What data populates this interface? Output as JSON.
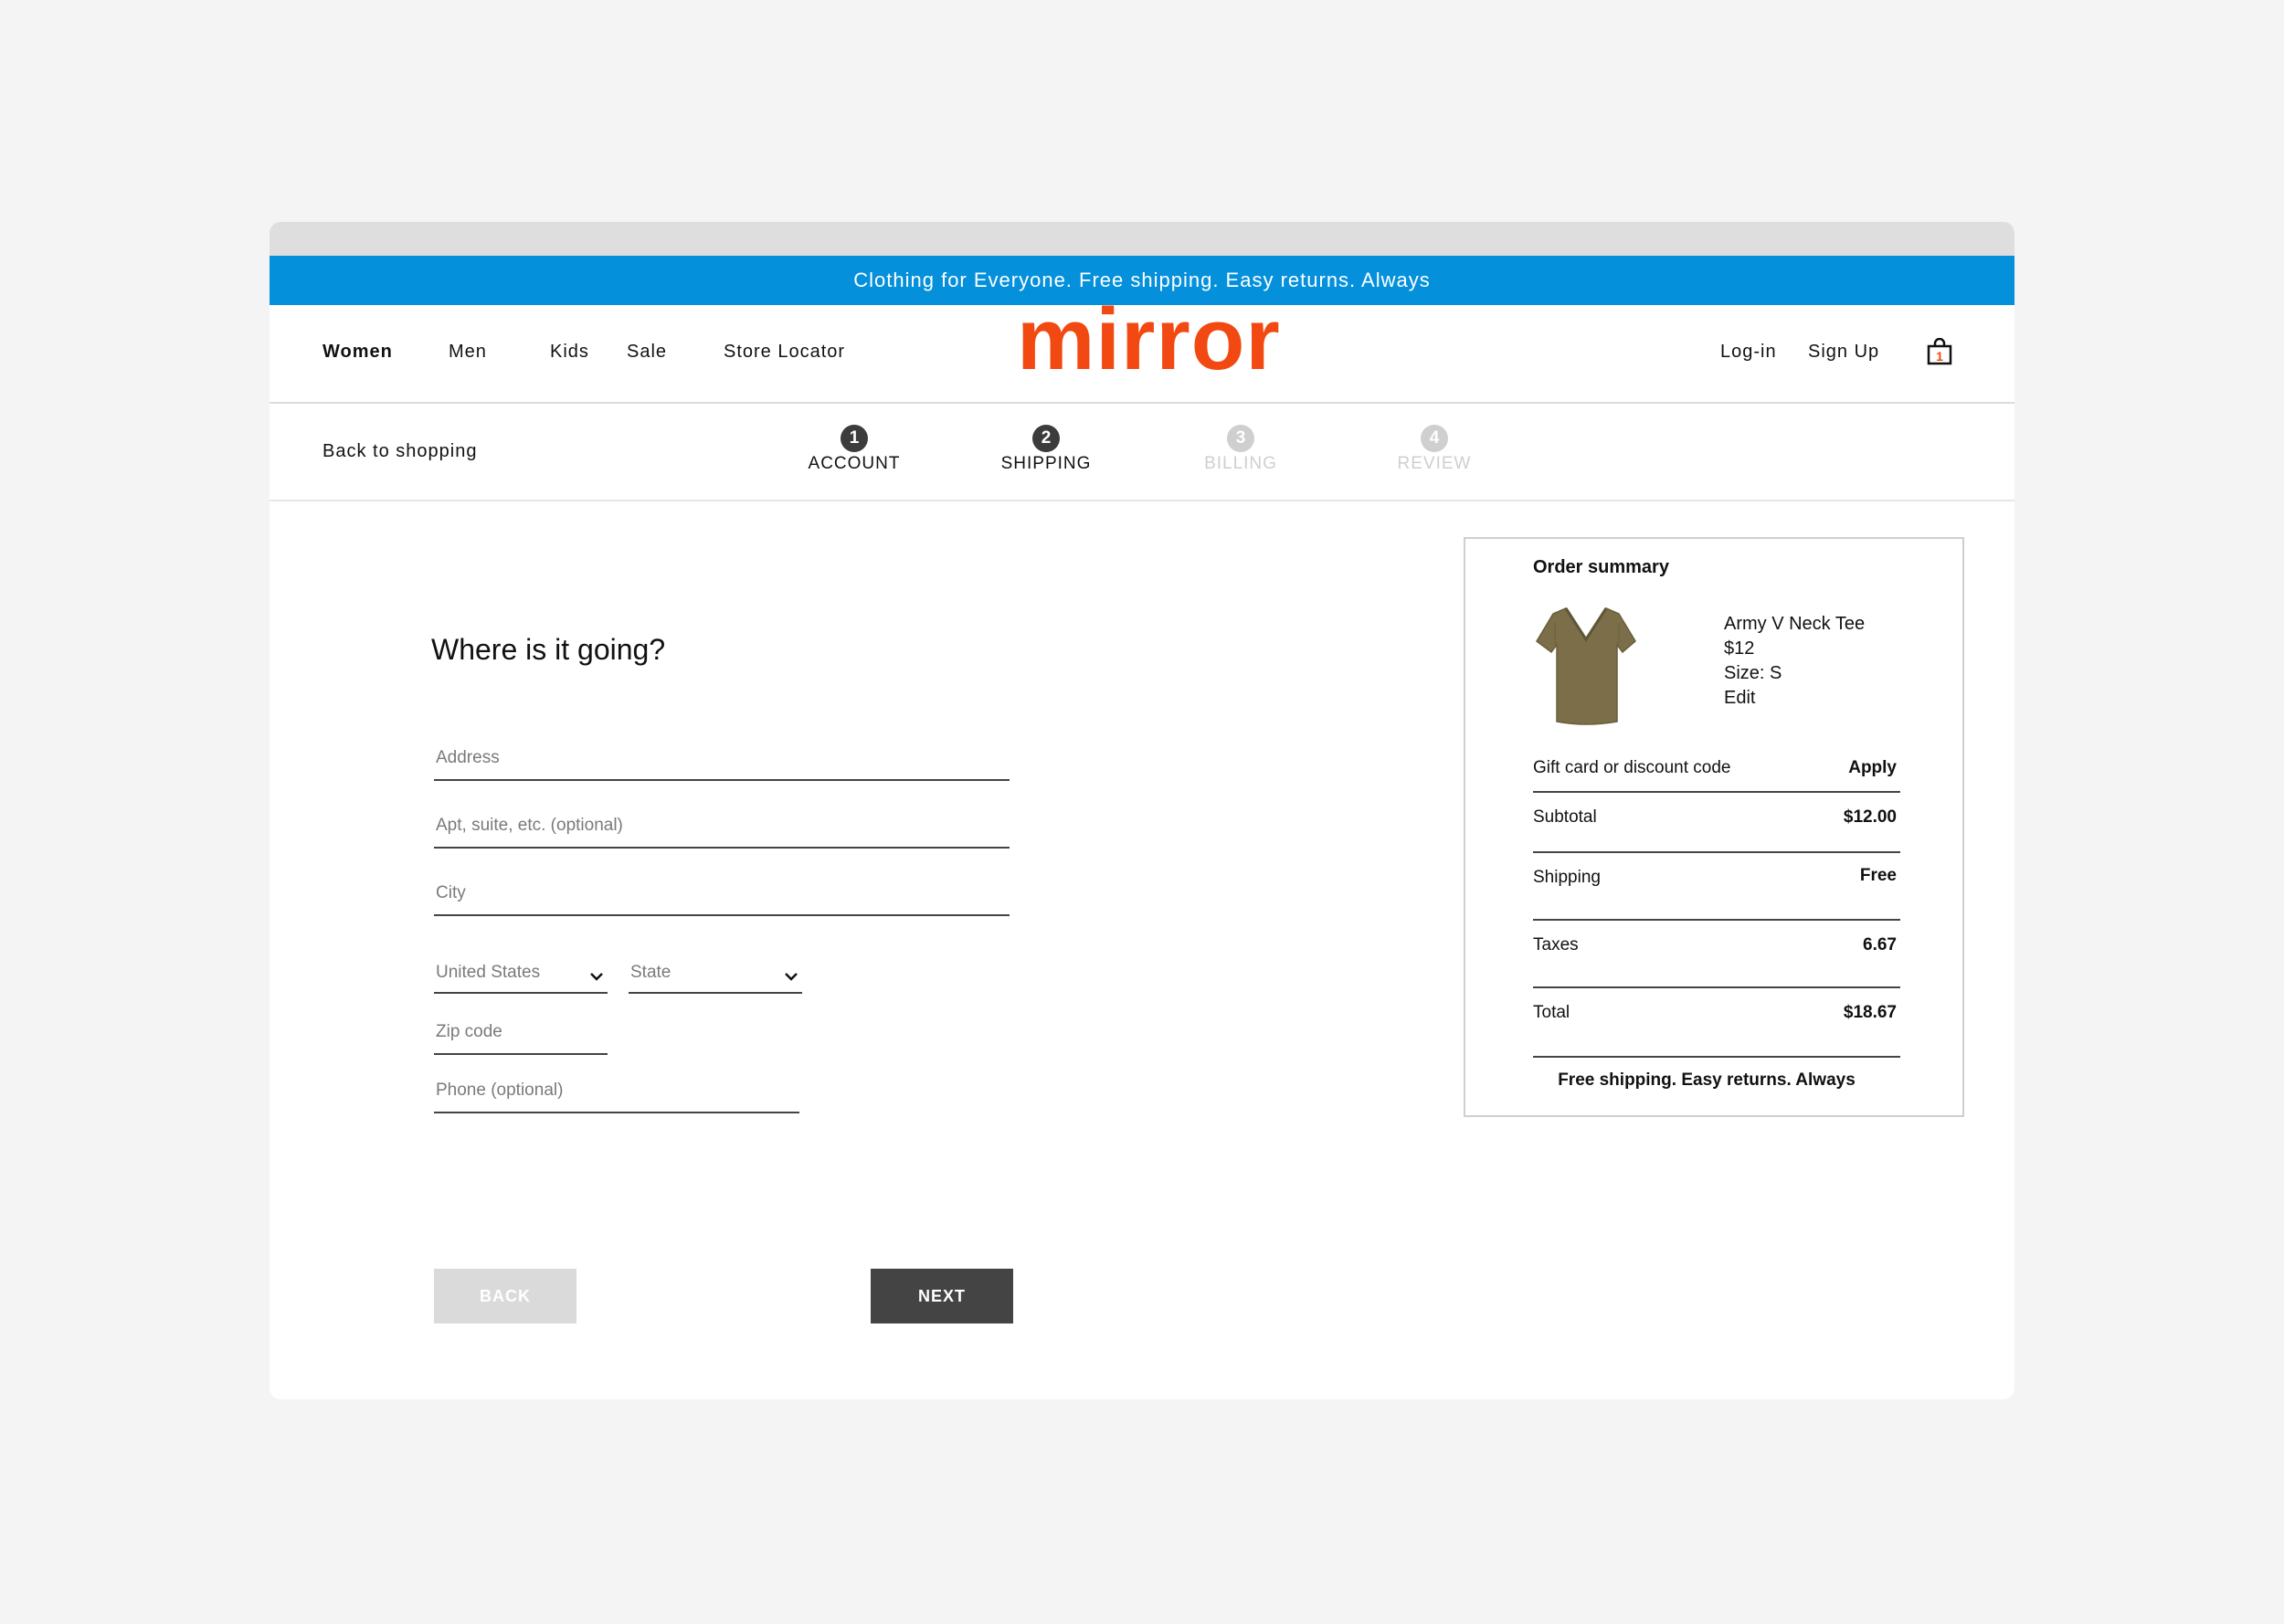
{
  "promo": {
    "text": "Clothing for Everyone. Free shipping. Easy returns. Always"
  },
  "header": {
    "nav": [
      "Women",
      "Men",
      "Kids",
      "Sale",
      "Store Locator"
    ],
    "logo": "mirror",
    "login": "Log-in",
    "signup": "Sign Up",
    "cart_icon": "shopping-bag-icon",
    "cart_count": "1",
    "accent_color": "#f24912"
  },
  "steps_bar": {
    "back_to_shopping": "Back to shopping",
    "steps": [
      {
        "number": "1",
        "label": "ACCOUNT",
        "state": "done"
      },
      {
        "number": "2",
        "label": "SHIPPING",
        "state": "current"
      },
      {
        "number": "3",
        "label": "BILLING",
        "state": "todo"
      },
      {
        "number": "4",
        "label": "REVIEW",
        "state": "todo"
      }
    ]
  },
  "form": {
    "title": "Where is it going?",
    "address_placeholder": "Address",
    "apt_placeholder": "Apt, suite, etc. (optional)",
    "city_placeholder": "City",
    "country_value": "United States",
    "state_value": "State",
    "zip_placeholder": "Zip code",
    "phone_placeholder": "Phone (optional)",
    "back_label": "BACK",
    "next_label": "NEXT"
  },
  "summary": {
    "title": "Order summary",
    "item": {
      "name": "Army V Neck Tee",
      "price": "$12",
      "size": "Size: S",
      "edit": "Edit",
      "color": "#7b6e48"
    },
    "discount_label": "Gift card or discount code",
    "apply_label": "Apply",
    "subtotal_label": "Subtotal",
    "subtotal_value": "$12.00",
    "shipping_label": "Shipping",
    "shipping_value": "Free",
    "taxes_label": "Taxes",
    "taxes_value": "6.67",
    "total_label": "Total",
    "total_value": "$18.67",
    "footnote": "Free shipping. Easy returns. Always"
  },
  "colors": {
    "promo_blue": "#0590dc",
    "dark_button": "#444444",
    "disabled_button": "#dadada"
  }
}
